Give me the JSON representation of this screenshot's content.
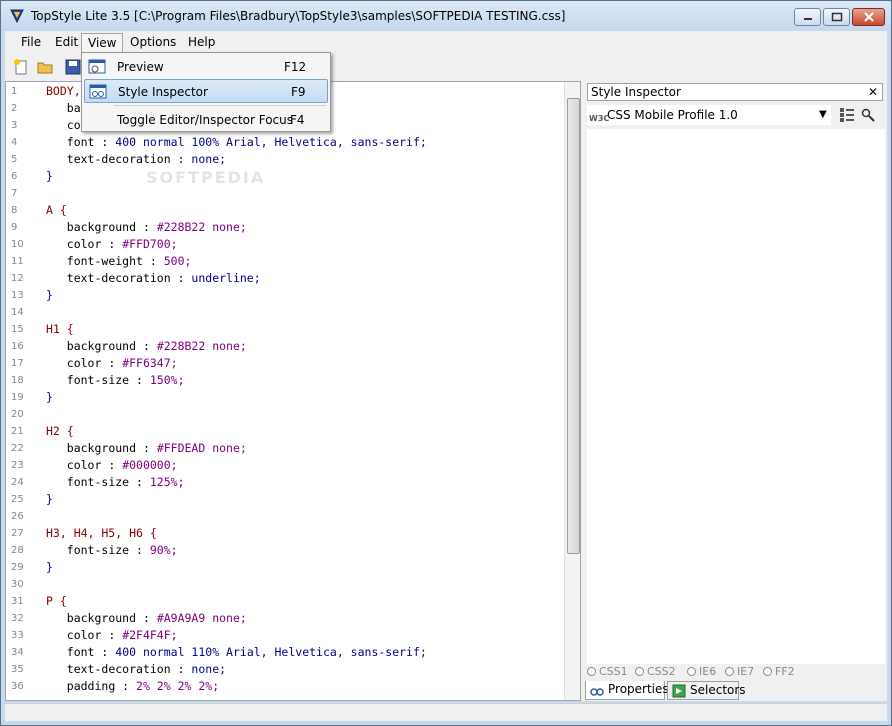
{
  "window": {
    "title": "TopStyle Lite 3.5 [C:\\Program Files\\Bradbury\\TopStyle3\\samples\\SOFTPEDIA TESTING.css]"
  },
  "menubar": {
    "file": "File",
    "edit": "Edit",
    "view": "View",
    "options": "Options",
    "help": "Help"
  },
  "view_menu": {
    "items": [
      {
        "label": "Preview",
        "shortcut": "F12"
      },
      {
        "label": "Style Inspector",
        "shortcut": "F9"
      },
      {
        "label": "Toggle Editor/Inspector Focus",
        "shortcut": "F4"
      }
    ]
  },
  "watermark": "SOFTPEDIA",
  "editor": {
    "line_numbers": [
      "1",
      "2",
      "3",
      "4",
      "5",
      "6",
      "7",
      "8",
      "9",
      "10",
      "11",
      "12",
      "13",
      "14",
      "15",
      "16",
      "17",
      "18",
      "19",
      "20",
      "21",
      "22",
      "23",
      "24",
      "25",
      "26",
      "27",
      "28",
      "29",
      "30",
      "31",
      "32",
      "33",
      "34",
      "35",
      "36"
    ],
    "lines": {
      "l1": "BODY,",
      "l2": "ba",
      "l3": "co",
      "l4_prop": "font",
      "l4_val": "400 normal 100% Arial, Helvetica, sans-serif;",
      "l5_prop": "text-decoration",
      "l5_val": "none;",
      "l6": "}",
      "l8": "A {",
      "l9_prop": "background",
      "l9_val": "#228B22 none;",
      "l10_prop": "color",
      "l10_val": "#FFD700;",
      "l11_prop": "font-weight",
      "l11_val": "500;",
      "l12_prop": "text-decoration",
      "l12_val": "underline;",
      "l13": "}",
      "l15": "H1 {",
      "l16_prop": "background",
      "l16_val": "#228B22 none;",
      "l17_prop": "color",
      "l17_val": "#FF6347;",
      "l18_prop": "font-size",
      "l18_val": "150%;",
      "l19": "}",
      "l21": "H2 {",
      "l22_prop": "background",
      "l22_val": "#FFDEAD none;",
      "l23_prop": "color",
      "l23_val": "#000000;",
      "l24_prop": "font-size",
      "l24_val": "125%;",
      "l25": "}",
      "l27": "H3, H4, H5, H6 {",
      "l28_prop": "font-size",
      "l28_val": "90%;",
      "l29": "}",
      "l31": "P {",
      "l32_prop": "background",
      "l32_val": "#A9A9A9 none;",
      "l33_prop": "color",
      "l33_val": "#2F4F4F;",
      "l34_prop": "font",
      "l34_val": "400 normal 110% Arial, Helvetica, sans-serif;",
      "l35_prop": "text-decoration",
      "l35_val": "none;",
      "l36_prop": "padding",
      "l36_val": "2% 2% 2% 2%;"
    }
  },
  "inspector": {
    "title": "Style Inspector",
    "close": "✕",
    "profile": "CSS Mobile Profile 1.0",
    "w3c": "W3C",
    "browsers": [
      "CSS1",
      "CSS2",
      "IE6",
      "IE7",
      "FF2"
    ],
    "tabs": {
      "properties": "Properties",
      "selectors": "Selectors"
    }
  },
  "colors": {
    "titlebar": "#c6d8ee",
    "selector": "#8b0000",
    "value": "#00008b",
    "highlight": "#c3dcf5"
  }
}
